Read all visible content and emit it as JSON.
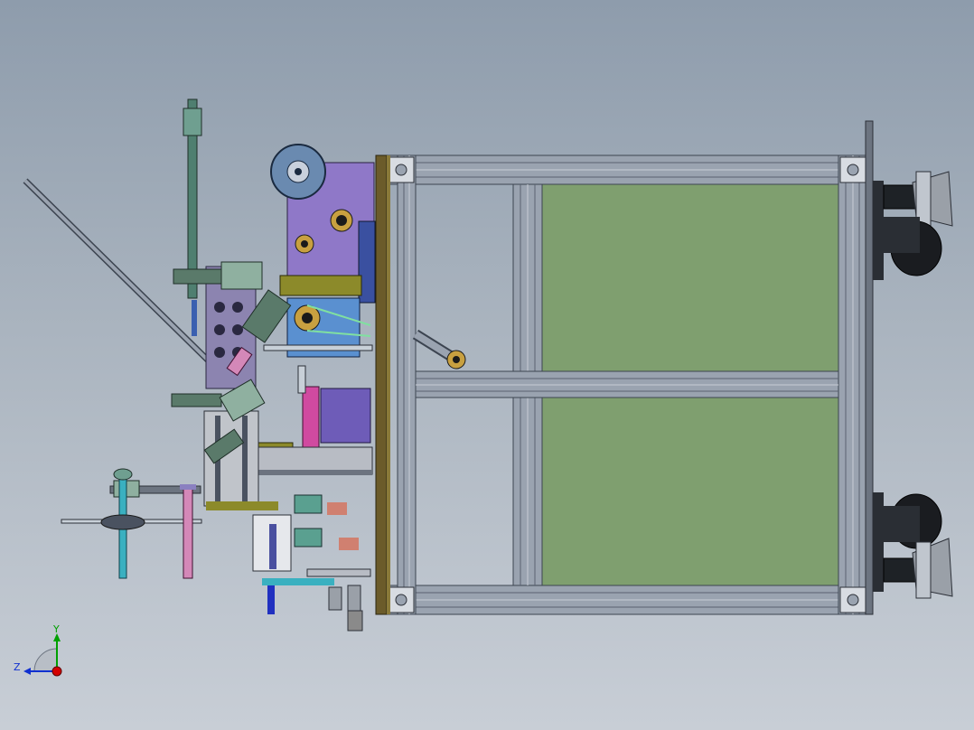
{
  "view": {
    "background_top": "#8e9cac",
    "background_bottom": "#c8ced6"
  },
  "triad": {
    "y_label": "Y",
    "z_label": "Z",
    "x_color": "#d40000",
    "y_color": "#00a000",
    "z_color": "#1030d0"
  },
  "colors": {
    "frame_profile": "#9aa3b0",
    "frame_dark": "#4a5260",
    "panel_green": "#7f9f6f",
    "base_plate": "#6b5b2a",
    "purple_block": "#8f78c8",
    "blue_part": "#5a90d0",
    "cyan_shaft": "#3aa0c0",
    "pink_part": "#d488b8",
    "olive_part": "#8c8a2a",
    "magenta_part": "#d04aa0",
    "teal_column": "#4f7f70"
  }
}
